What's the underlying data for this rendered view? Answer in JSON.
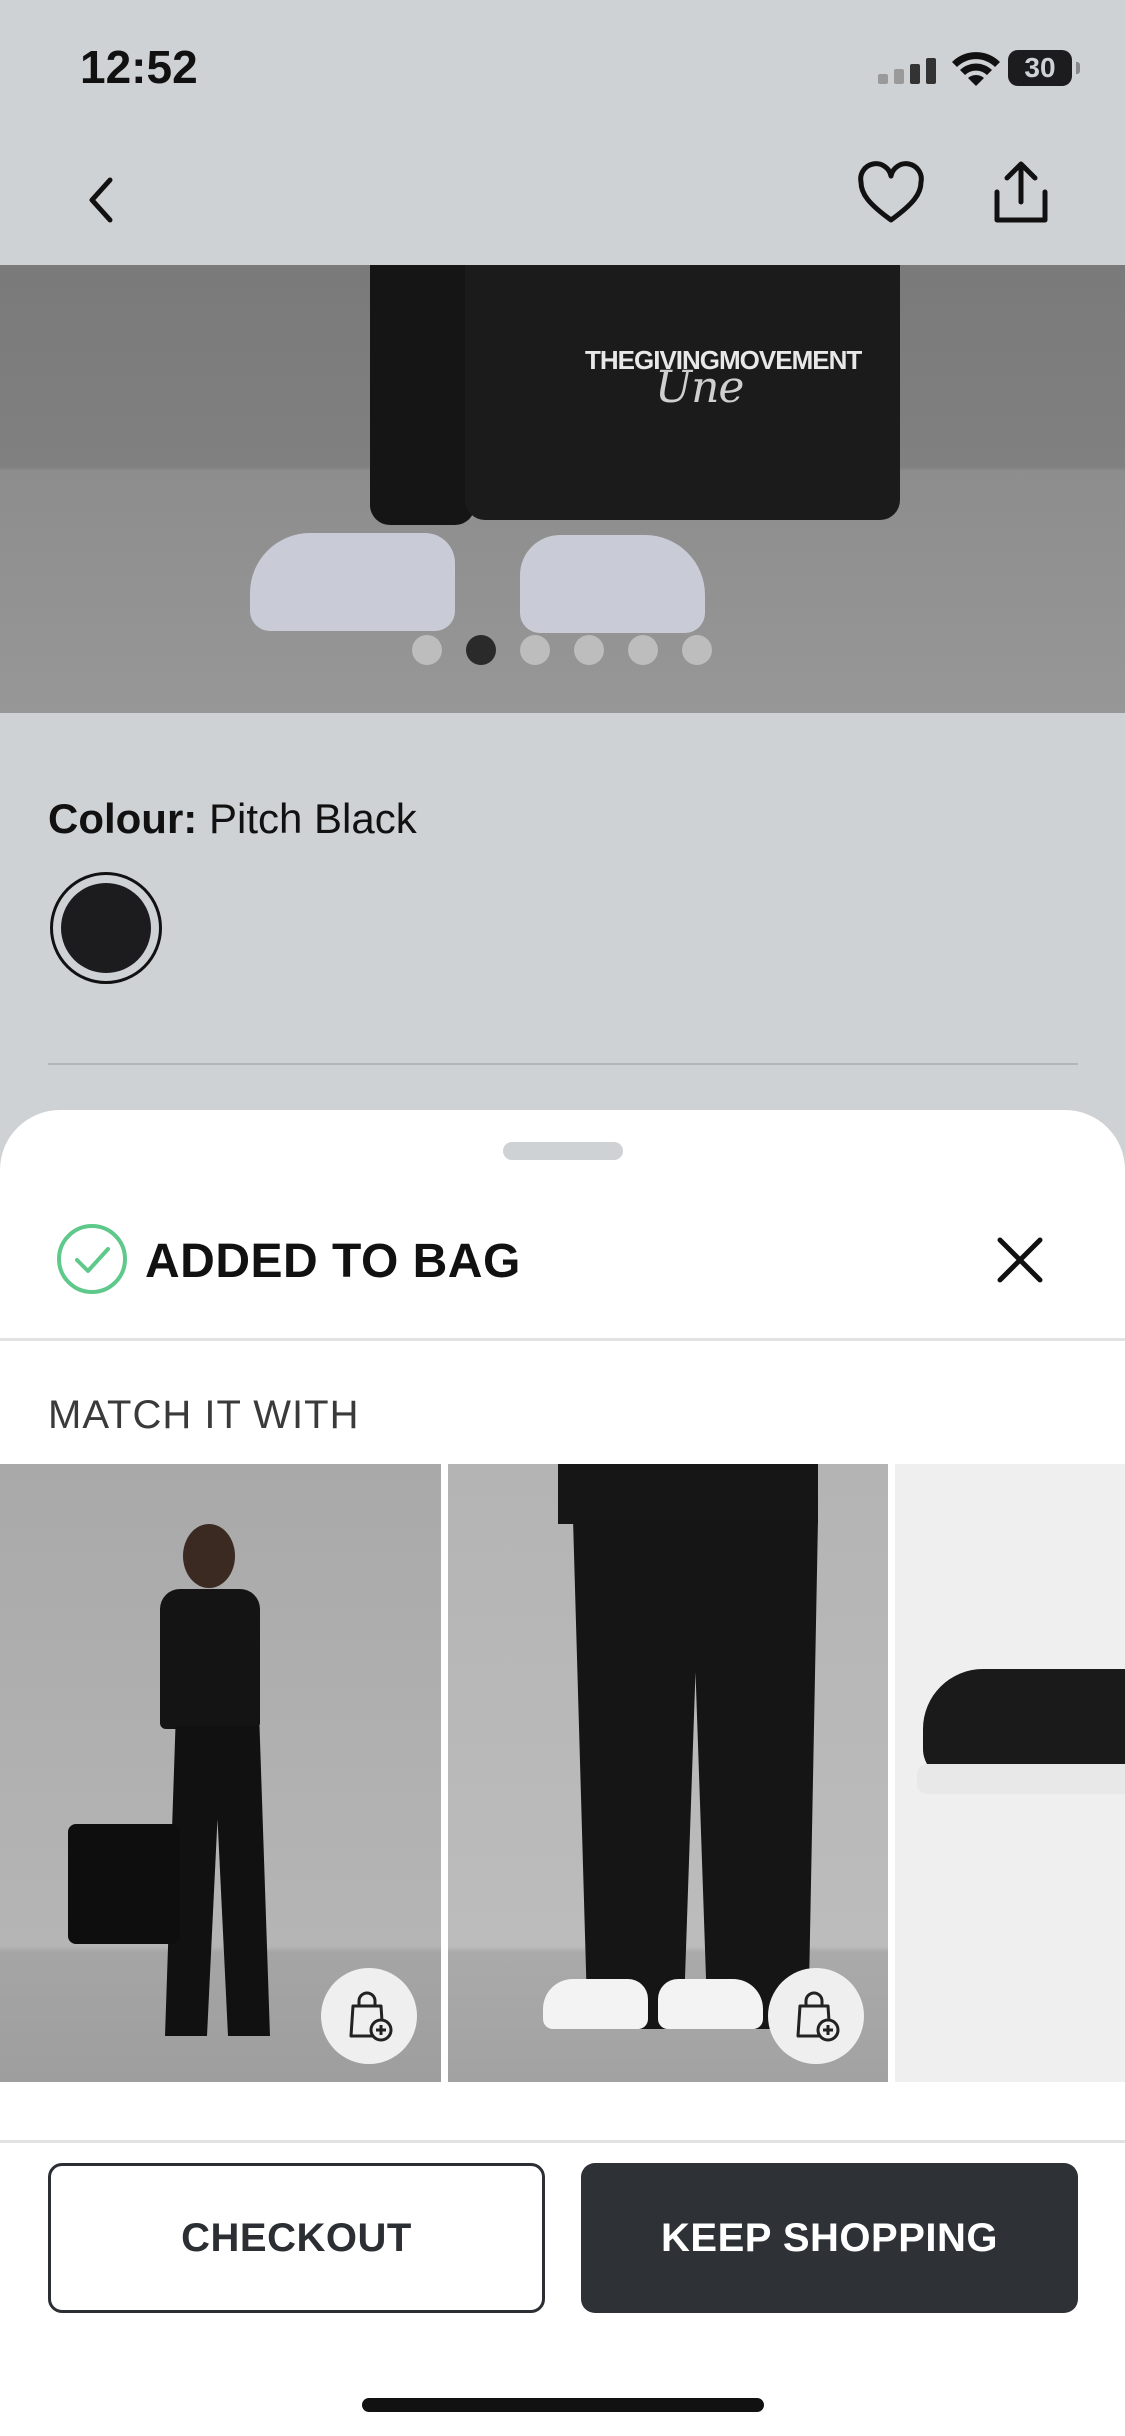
{
  "status_bar": {
    "time": "12:52",
    "battery": "30"
  },
  "product": {
    "brand_print": "THEGIVINGMOVEMENT",
    "brand_script": "Une",
    "image_count": 6,
    "active_image": 2,
    "colour_label": "Colour:",
    "colour_value": "Pitch Black",
    "selected_swatch_color": "#1c1c1e"
  },
  "sheet": {
    "title": "ADDED TO BAG",
    "match_title": "MATCH IT WITH",
    "items": [
      {
        "name": "black-tee-flare-set"
      },
      {
        "name": "black-joggers"
      },
      {
        "name": "black-white-sneakers"
      }
    ],
    "checkout_label": "CHECKOUT",
    "keep_shopping_label": "KEEP SHOPPING"
  },
  "colors": {
    "success": "#5ec98a",
    "primary_button": "#2e3136",
    "page_bg": "#cfd2d5"
  }
}
